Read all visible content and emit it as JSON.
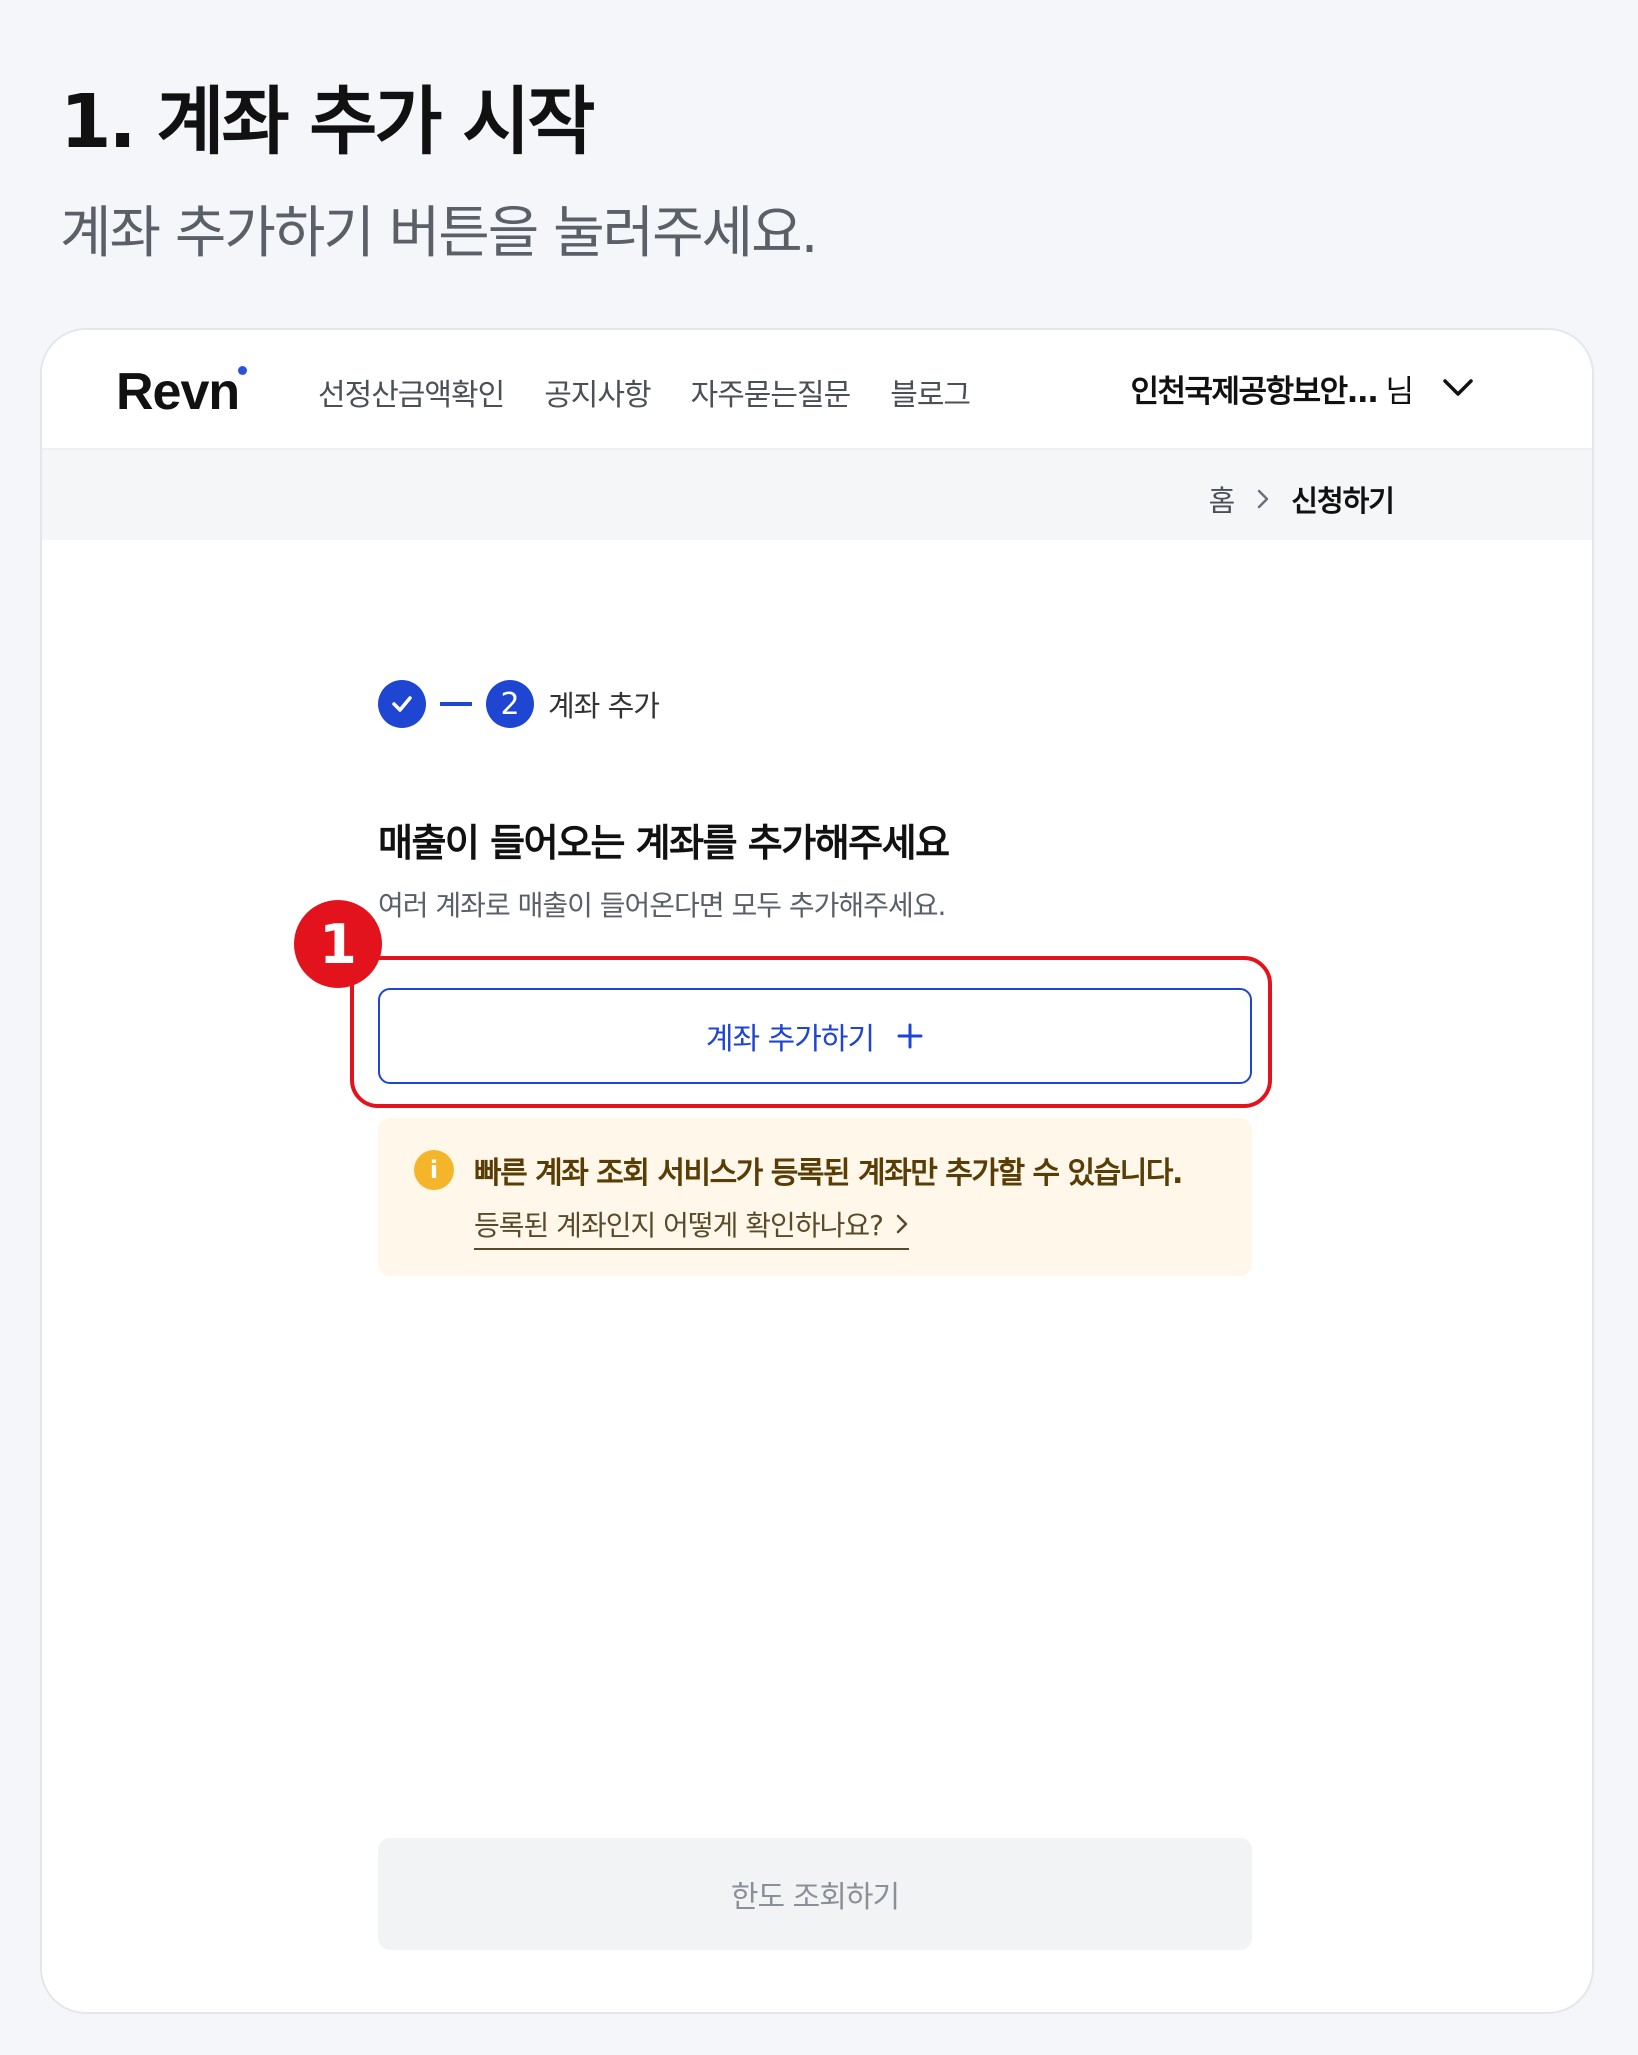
{
  "guide": {
    "title": "1. 계좌 추가 시작",
    "subtitle": "계좌 추가하기 버튼을 눌러주세요."
  },
  "header": {
    "logo": "Revn",
    "nav": [
      "선정산금액확인",
      "공지사항",
      "자주묻는질문",
      "블로그"
    ],
    "user_name": "인천국제공항보안...",
    "user_suffix": "님"
  },
  "breadcrumb": {
    "home": "홈",
    "current": "신청하기"
  },
  "stepper": {
    "current_number": "2",
    "current_label": "계좌 추가"
  },
  "main": {
    "title": "매출이 들어오는 계좌를 추가해주세요",
    "description": "여러 계좌로 매출이 들어온다면 모두 추가해주세요.",
    "add_button": "계좌 추가하기",
    "badge_number": "1",
    "notice_text": "빠른 계좌 조회 서비스가 등록된 계좌만 추가할 수 있습니다.",
    "notice_link": "등록된 계좌인지 어떻게 확인하나요?",
    "limit_button": "한도 조회하기"
  },
  "colors": {
    "primary": "#1f45d3",
    "highlight": "#e3131d",
    "notice_bg": "#fff8ea",
    "info_icon": "#f4b52a"
  }
}
